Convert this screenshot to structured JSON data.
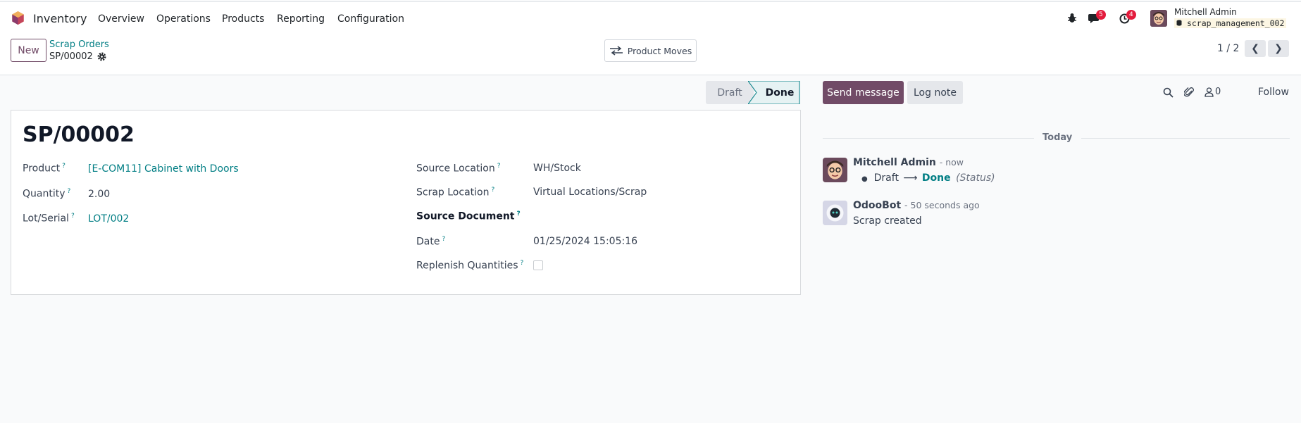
{
  "app": {
    "name": "Inventory",
    "brand_color": "#714b67",
    "link_color": "#017e84"
  },
  "menu": [
    "Overview",
    "Operations",
    "Products",
    "Reporting",
    "Configuration"
  ],
  "systray": {
    "messages_count": "5",
    "activities_count": "4",
    "user_name": "Mitchell Admin",
    "database": "scrap_management_002"
  },
  "control": {
    "new_label": "New",
    "breadcrumb_parent": "Scrap Orders",
    "breadcrumb_current": "SP/00002",
    "product_moves_label": "Product Moves",
    "pager_value": "1 / 2"
  },
  "status": {
    "steps": [
      "Draft",
      "Done"
    ],
    "current": "Done"
  },
  "form": {
    "title": "SP/00002",
    "product_label": "Product",
    "product_value": "[E-COM11] Cabinet with Doors",
    "quantity_label": "Quantity",
    "quantity_value": "2.00",
    "lot_label": "Lot/Serial",
    "lot_value": "LOT/002",
    "source_location_label": "Source Location",
    "source_location_value": "WH/Stock",
    "scrap_location_label": "Scrap Location",
    "scrap_location_value": "Virtual Locations/Scrap",
    "source_document_label": "Source Document",
    "date_label": "Date",
    "date_value": "01/25/2024 15:05:16",
    "replenish_label": "Replenish Quantities",
    "replenish_checked": false
  },
  "chatter": {
    "send_message": "Send message",
    "log_note": "Log note",
    "followers_count": "0",
    "follow_label": "Follow",
    "date_separator": "Today",
    "messages": [
      {
        "author": "Mitchell Admin",
        "time": "- now",
        "from": "Draft",
        "arrow": "⟶",
        "to": "Done",
        "field": "(Status)"
      },
      {
        "author": "OdooBot",
        "time": "- 50 seconds ago",
        "body": "Scrap created"
      }
    ]
  },
  "icons": [
    "bug-icon",
    "chat-icon",
    "clock-icon",
    "gear-icon",
    "transfer-icon",
    "chevron-left-icon",
    "chevron-right-icon",
    "search-icon",
    "paperclip-icon",
    "user-icon"
  ]
}
